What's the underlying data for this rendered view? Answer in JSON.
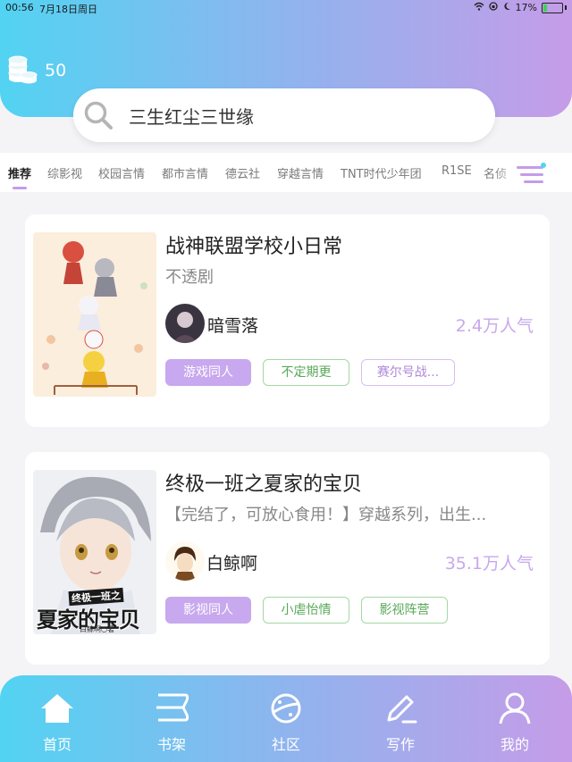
{
  "status": {
    "time": "00:56",
    "date": "7月18日周日",
    "battery": "17%"
  },
  "user": {
    "coins": "50"
  },
  "search": {
    "placeholder": "三生红尘三世缘"
  },
  "tabs": [
    {
      "label": "推荐",
      "active": true
    },
    {
      "label": "综影视"
    },
    {
      "label": "校园言情"
    },
    {
      "label": "都市言情"
    },
    {
      "label": "德云社"
    },
    {
      "label": "穿越言情"
    },
    {
      "label": "TNT时代少年团"
    },
    {
      "label": "R1SE"
    },
    {
      "label": "名侦"
    }
  ],
  "books": [
    {
      "title": "战神联盟学校小日常",
      "subtitle": "不透剧",
      "author": "暗雪落",
      "popularity": "2.4万人气",
      "tags": [
        "游戏同人",
        "不定期更",
        "赛尔号战..."
      ]
    },
    {
      "title": "终极一班之夏家的宝贝",
      "subtitle": "【完结了，可放心食用！】穿越系列，出生...",
      "author": "白鲸啊",
      "popularity": "35.1万人气",
      "tags": [
        "影视同人",
        "小虐怡情",
        "影视阵营"
      ],
      "cover_text": {
        "top": "终极一班之",
        "main": "夏家的宝贝",
        "small": "白鲸啊○著"
      }
    }
  ],
  "nav": [
    {
      "label": "首页",
      "icon": "home-icon"
    },
    {
      "label": "书架",
      "icon": "bookshelf-icon"
    },
    {
      "label": "社区",
      "icon": "planet-icon"
    },
    {
      "label": "写作",
      "icon": "pen-icon"
    },
    {
      "label": "我的",
      "icon": "user-icon"
    }
  ],
  "colors": {
    "gradient_start": "#52d3f2",
    "gradient_end": "#c59ce8",
    "accent": "#c8a8ee",
    "tag_green": "#58a858"
  }
}
